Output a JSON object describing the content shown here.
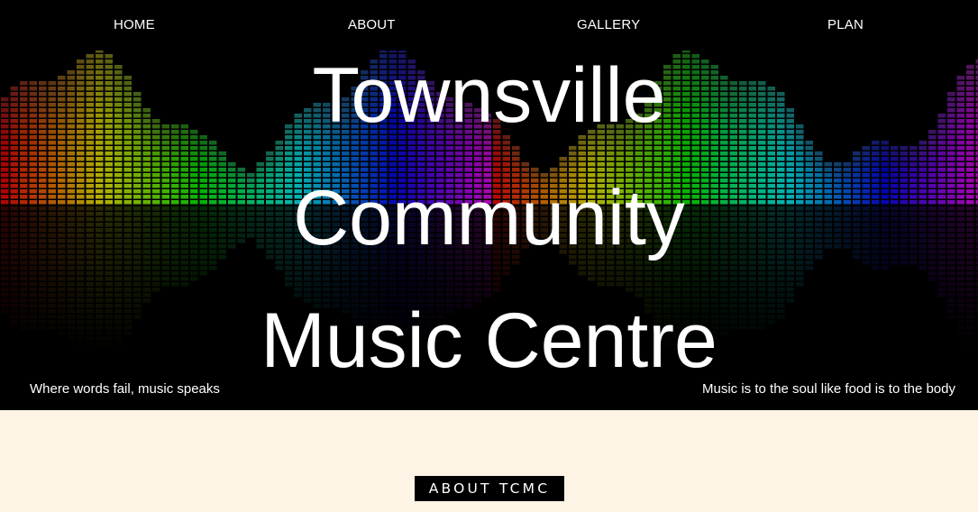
{
  "nav": {
    "items": [
      "HOME",
      "ABOUT",
      "GALLERY",
      "PLAN"
    ]
  },
  "hero": {
    "title_lines": [
      "Townsville",
      "Community",
      "Music Centre"
    ],
    "tagline_left": "Where words fail, music speaks",
    "tagline_right": "Music is to the soul like food is to the body"
  },
  "about": {
    "heading": "ABOUT TCMC"
  },
  "colors": {
    "page_background": "#fdf4e6",
    "hero_background": "#000000",
    "text": "#ffffff"
  }
}
